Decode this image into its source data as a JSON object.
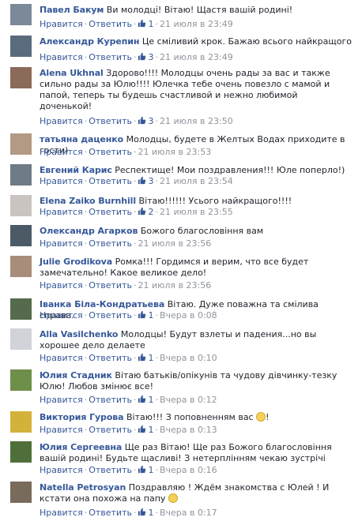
{
  "labels": {
    "like": "Нравится",
    "reply": "Ответить",
    "dot": "·"
  },
  "colors": {
    "link": "#365899",
    "meta": "#90949c",
    "text": "#1d2129"
  },
  "comments": [
    {
      "author": "Павел Бакум",
      "text": "Ви молодці! Вітаю! Щастя вашій родині!",
      "likes": "1",
      "time": "21 июля в 23:49",
      "avatar_color": "#7a8a99"
    },
    {
      "author": "Александр Курепин",
      "text": "Це сміливий крок. Бажаю всього найкращого",
      "likes": "3",
      "time": "21 июля в 23:49",
      "avatar_color": "#5b6b7e"
    },
    {
      "author": "Alena Ukhnal",
      "text": "Здорово!!!! Молодцы очень рады за вас и также сильно рады за Юлю!!!! Юлечка тебе очень повезло с мамой и папой, теперь ты будешь счастливой и нежно любимой доченькой!",
      "likes": "3",
      "time": "21 июля в 23:50",
      "avatar_color": "#8a6a58"
    },
    {
      "author": "татьяна даценко",
      "text": "Молодцы, будете в Желтых Водах приходите в гости)",
      "likes": "",
      "time": "21 июля в 23:53",
      "avatar_color": "#b39a84"
    },
    {
      "author": "Евгений Карис",
      "text": "Респектище! Мои поздравления!!! Юле поперло!)",
      "likes": "3",
      "time": "21 июля в 23:54",
      "avatar_color": "#6f7b86"
    },
    {
      "author": "Elena Zaiko Burnhill",
      "text": "Вітаю!!!!!! Усього найкращого!!!!",
      "likes": "2",
      "time": "21 июля в 23:55",
      "avatar_color": "#c9c4bf"
    },
    {
      "author": "Олександр Агарков",
      "text": "Божого благословіння вам",
      "likes": "",
      "time": "21 июля в 23:56",
      "avatar_color": "#4b5a66"
    },
    {
      "author": "Julie Grodikova",
      "text": "Ромка!!! Гордимся и верим, что все будет замечательно! Какое великое дело!",
      "likes": "",
      "time": "21 июля в 23:56",
      "avatar_color": "#a88e7a"
    },
    {
      "author": "Іванка Біла-Кондратьева",
      "text": "Вітаю. Дуже поважна та смілива справа.",
      "likes": "1",
      "time": "Вчера в 0:08",
      "avatar_color": "#556b4e"
    },
    {
      "author": "Alla Vasilchenko",
      "text": "Молодцы! Будут взлеты и падения...но вы хорошее дело делаете",
      "likes": "1",
      "time": "Вчера в 0:10",
      "avatar_color": "#d0d3d8"
    },
    {
      "author": "Юлия Стадник",
      "text": "Вітаю батьків/опікунів та чудову дівчинку-тезку Юлю! Любов змінює все!",
      "likes": "1",
      "time": "Вчера в 0:12",
      "avatar_color": "#6e8f4a"
    },
    {
      "author": "Виктория Гурова",
      "text": "Вітаю!!! З поповненням вас",
      "emoji_end": "!",
      "likes": "1",
      "time": "Вчера в 0:13",
      "avatar_color": "#d4b23a"
    },
    {
      "author": "Юлия Сергеевна",
      "text": "Ще раз Вітаю! Ще раз Божого благословіння вашій родині! Будьте щасливі! З нетерплінням чекаю зустрічі",
      "likes": "1",
      "time": "Вчера в 0:16",
      "avatar_color": "#4f6f3a"
    },
    {
      "author": "Natella Petrosyan",
      "text": "Поздравляю ! Ждём знакомства с Юлей ! И кстати она похожа на папу",
      "likes": "1",
      "time": "Вчера в 0:17",
      "avatar_color": "#7a6a5c"
    }
  ]
}
